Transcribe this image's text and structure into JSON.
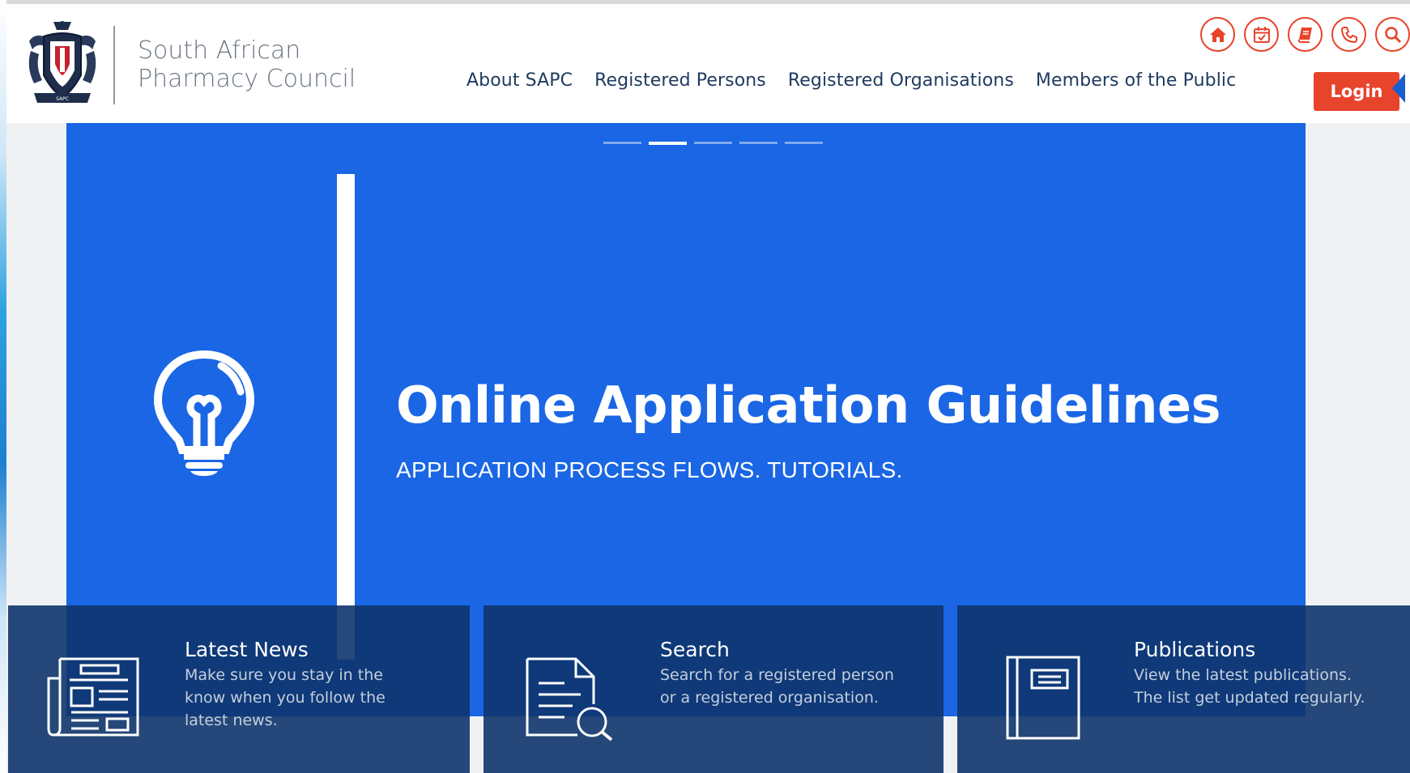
{
  "site": {
    "name_line1": "South African",
    "name_line2": "Pharmacy Council"
  },
  "utility_icons": [
    "home-icon",
    "calendar-icon",
    "book-icon",
    "phone-icon",
    "search-icon"
  ],
  "nav": {
    "items": [
      {
        "label": "About SAPC"
      },
      {
        "label": "Registered Persons"
      },
      {
        "label": "Registered Organisations"
      },
      {
        "label": "Members of the Public"
      }
    ],
    "login_label": "Login"
  },
  "hero": {
    "slide_count": 5,
    "active_slide": 2,
    "title": "Online Application Guidelines",
    "subtitle": "APPLICATION PROCESS FLOWS. TUTORIALS.",
    "icon": "lightbulb-icon"
  },
  "cards": [
    {
      "icon": "newspaper-icon",
      "title": "Latest News",
      "description": "Make sure you stay in the know when you follow the latest news."
    },
    {
      "icon": "document-search-icon",
      "title": "Search",
      "description": "Search for a registered person or a registered organisation."
    },
    {
      "icon": "book-icon",
      "title": "Publications",
      "description": "View the latest publications. The list get updated regularly."
    }
  ],
  "colors": {
    "accent": "#e8432b",
    "hero_blue": "#1a66e5",
    "card_navy": "#0e346c",
    "nav_text": "#1e3a5f"
  }
}
